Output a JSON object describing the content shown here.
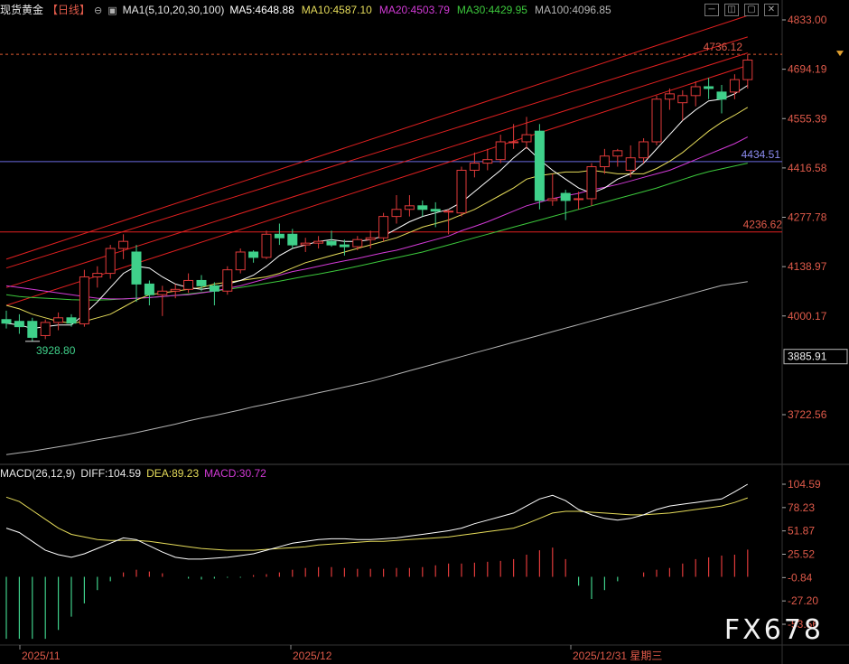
{
  "header": {
    "symbol": "现货黄金",
    "period": "【日线】",
    "ma_group": "MA1(5,10,20,30,100)",
    "ma5": "MA5:4648.88",
    "ma10": "MA10:4587.10",
    "ma20": "MA20:4503.79",
    "ma30": "MA30:4429.95",
    "ma100": "MA100:4096.85"
  },
  "macd_header": {
    "name": "MACD(26,12,9)",
    "diff": "DIFF:104.59",
    "dea": "DEA:89.23",
    "macd": "MACD:30.72"
  },
  "colors": {
    "up": "#e03a3a",
    "down": "#3fd08a",
    "ma5": "#ffffff",
    "ma10": "#e6dc5a",
    "ma20": "#d23ad6",
    "ma30": "#3cc83c",
    "ma100": "#b4b4b4",
    "channel": "#e02020",
    "diff": "#ffffff",
    "dea": "#e6dc5a"
  },
  "watermark": "FX678",
  "chart_data": {
    "type": "candlestick",
    "price_axis": {
      "ticks": [
        "4833.00",
        "4694.19",
        "4555.39",
        "4416.58",
        "4277.78",
        "4138.97",
        "4000.17",
        "3722.56"
      ]
    },
    "price_labels": {
      "last": "3885.91",
      "high_marker": "4736.12",
      "low_marker": "3928.80",
      "blue_level": "4434.51",
      "red_level": "4236.62"
    },
    "macd_axis": {
      "ticks": [
        "104.59",
        "78.23",
        "51.87",
        "25.52",
        "-0.84",
        "-27.20",
        "-53.56"
      ]
    },
    "time_axis": {
      "labels": [
        "2025/11",
        "2025/12",
        "2025/12/31 星期三"
      ]
    },
    "horizontal_levels": [
      4736.12,
      4434.51,
      4236.62
    ],
    "channel_lines": [
      {
        "from": [
          0,
          4160
        ],
        "to": [
          57,
          4845
        ]
      },
      {
        "from": [
          0,
          4135
        ],
        "to": [
          57,
          4785
        ]
      },
      {
        "from": [
          0,
          4080
        ],
        "to": [
          57,
          4740
        ]
      },
      {
        "from": [
          0,
          4030
        ],
        "to": [
          57,
          4705
        ]
      }
    ],
    "candles": [
      {
        "o": 3990,
        "h": 4015,
        "l": 3965,
        "c": 3980
      },
      {
        "o": 3985,
        "h": 4005,
        "l": 3950,
        "c": 3970
      },
      {
        "o": 3985,
        "h": 3995,
        "l": 3928.8,
        "c": 3940
      },
      {
        "o": 3945,
        "h": 3990,
        "l": 3935,
        "c": 3982
      },
      {
        "o": 3982,
        "h": 4010,
        "l": 3960,
        "c": 3995
      },
      {
        "o": 3995,
        "h": 4005,
        "l": 3970,
        "c": 3980
      },
      {
        "o": 3978,
        "h": 4130,
        "l": 3970,
        "c": 4110
      },
      {
        "o": 4110,
        "h": 4140,
        "l": 4080,
        "c": 4120
      },
      {
        "o": 4120,
        "h": 4200,
        "l": 4105,
        "c": 4190
      },
      {
        "o": 4190,
        "h": 4230,
        "l": 4160,
        "c": 4210
      },
      {
        "o": 4180,
        "h": 4200,
        "l": 4040,
        "c": 4090
      },
      {
        "o": 4090,
        "h": 4100,
        "l": 4030,
        "c": 4060
      },
      {
        "o": 4060,
        "h": 4085,
        "l": 4000,
        "c": 4070
      },
      {
        "o": 4070,
        "h": 4090,
        "l": 4050,
        "c": 4075
      },
      {
        "o": 4075,
        "h": 4120,
        "l": 4065,
        "c": 4100
      },
      {
        "o": 4100,
        "h": 4115,
        "l": 4070,
        "c": 4085
      },
      {
        "o": 4085,
        "h": 4095,
        "l": 4030,
        "c": 4070
      },
      {
        "o": 4070,
        "h": 4140,
        "l": 4060,
        "c": 4130
      },
      {
        "o": 4130,
        "h": 4190,
        "l": 4120,
        "c": 4180
      },
      {
        "o": 4180,
        "h": 4185,
        "l": 4150,
        "c": 4165
      },
      {
        "o": 4165,
        "h": 4240,
        "l": 4160,
        "c": 4230
      },
      {
        "o": 4230,
        "h": 4260,
        "l": 4200,
        "c": 4220
      },
      {
        "o": 4230,
        "h": 4245,
        "l": 4190,
        "c": 4200
      },
      {
        "o": 4200,
        "h": 4220,
        "l": 4180,
        "c": 4205
      },
      {
        "o": 4205,
        "h": 4225,
        "l": 4190,
        "c": 4210
      },
      {
        "o": 4210,
        "h": 4240,
        "l": 4195,
        "c": 4200
      },
      {
        "o": 4200,
        "h": 4215,
        "l": 4170,
        "c": 4195
      },
      {
        "o": 4195,
        "h": 4225,
        "l": 4185,
        "c": 4215
      },
      {
        "o": 4215,
        "h": 4240,
        "l": 4190,
        "c": 4220
      },
      {
        "o": 4220,
        "h": 4290,
        "l": 4210,
        "c": 4280
      },
      {
        "o": 4280,
        "h": 4340,
        "l": 4260,
        "c": 4300
      },
      {
        "o": 4300,
        "h": 4340,
        "l": 4280,
        "c": 4310
      },
      {
        "o": 4310,
        "h": 4325,
        "l": 4280,
        "c": 4300
      },
      {
        "o": 4300,
        "h": 4320,
        "l": 4250,
        "c": 4295
      },
      {
        "o": 4295,
        "h": 4300,
        "l": 4230,
        "c": 4295
      },
      {
        "o": 4290,
        "h": 4420,
        "l": 4280,
        "c": 4410
      },
      {
        "o": 4410,
        "h": 4460,
        "l": 4390,
        "c": 4430
      },
      {
        "o": 4430,
        "h": 4470,
        "l": 4410,
        "c": 4440
      },
      {
        "o": 4440,
        "h": 4510,
        "l": 4430,
        "c": 4490
      },
      {
        "o": 4490,
        "h": 4540,
        "l": 4470,
        "c": 4490
      },
      {
        "o": 4490,
        "h": 4560,
        "l": 4470,
        "c": 4510
      },
      {
        "o": 4520,
        "h": 4540,
        "l": 4300,
        "c": 4325
      },
      {
        "o": 4325,
        "h": 4400,
        "l": 4310,
        "c": 4330
      },
      {
        "o": 4345,
        "h": 4355,
        "l": 4270,
        "c": 4325
      },
      {
        "o": 4330,
        "h": 4350,
        "l": 4300,
        "c": 4330
      },
      {
        "o": 4330,
        "h": 4430,
        "l": 4310,
        "c": 4420
      },
      {
        "o": 4420,
        "h": 4470,
        "l": 4400,
        "c": 4450
      },
      {
        "o": 4450,
        "h": 4470,
        "l": 4420,
        "c": 4465
      },
      {
        "o": 4410,
        "h": 4480,
        "l": 4390,
        "c": 4445
      },
      {
        "o": 4445,
        "h": 4500,
        "l": 4430,
        "c": 4490
      },
      {
        "o": 4490,
        "h": 4620,
        "l": 4480,
        "c": 4610
      },
      {
        "o": 4610,
        "h": 4640,
        "l": 4580,
        "c": 4625
      },
      {
        "o": 4600,
        "h": 4635,
        "l": 4550,
        "c": 4620
      },
      {
        "o": 4620,
        "h": 4660,
        "l": 4590,
        "c": 4645
      },
      {
        "o": 4645,
        "h": 4670,
        "l": 4610,
        "c": 4640
      },
      {
        "o": 4630,
        "h": 4650,
        "l": 4570,
        "c": 4610
      },
      {
        "o": 4630,
        "h": 4680,
        "l": 4610,
        "c": 4665
      },
      {
        "o": 4665,
        "h": 4736.12,
        "l": 4640,
        "c": 4720
      }
    ],
    "ma": {
      "ma5": [
        3980,
        3975,
        3965,
        3970,
        3975,
        3975,
        4005,
        4040,
        4080,
        4120,
        4140,
        4135,
        4110,
        4090,
        4080,
        4075,
        4080,
        4090,
        4100,
        4115,
        4140,
        4170,
        4190,
        4200,
        4210,
        4215,
        4210,
        4210,
        4215,
        4225,
        4245,
        4265,
        4280,
        4290,
        4300,
        4320,
        4350,
        4380,
        4410,
        4445,
        4475,
        4440,
        4410,
        4385,
        4360,
        4345,
        4360,
        4385,
        4400,
        4430,
        4470,
        4510,
        4550,
        4580,
        4605,
        4610,
        4625,
        4648.88
      ],
      "ma10": [
        4030,
        4020,
        4005,
        3995,
        3985,
        3980,
        3985,
        3995,
        4005,
        4025,
        4045,
        4060,
        4065,
        4070,
        4075,
        4080,
        4090,
        4095,
        4100,
        4105,
        4110,
        4120,
        4135,
        4150,
        4160,
        4170,
        4180,
        4190,
        4200,
        4210,
        4220,
        4235,
        4250,
        4260,
        4270,
        4285,
        4300,
        4320,
        4340,
        4360,
        4385,
        4395,
        4400,
        4405,
        4405,
        4410,
        4405,
        4400,
        4400,
        4400,
        4415,
        4435,
        4460,
        4490,
        4520,
        4545,
        4565,
        4587.1
      ],
      "ma20": [
        4085,
        4080,
        4075,
        4070,
        4065,
        4060,
        4055,
        4050,
        4048,
        4048,
        4050,
        4052,
        4055,
        4058,
        4060,
        4065,
        4070,
        4078,
        4085,
        4095,
        4105,
        4115,
        4125,
        4132,
        4140,
        4148,
        4155,
        4162,
        4170,
        4178,
        4185,
        4195,
        4205,
        4215,
        4225,
        4240,
        4252,
        4265,
        4280,
        4295,
        4310,
        4320,
        4330,
        4338,
        4345,
        4355,
        4362,
        4370,
        4380,
        4390,
        4400,
        4410,
        4425,
        4440,
        4455,
        4470,
        4485,
        4503.79
      ],
      "ma30": [
        4060,
        4055,
        4052,
        4050,
        4048,
        4046,
        4045,
        4045,
        4046,
        4048,
        4050,
        4052,
        4055,
        4058,
        4062,
        4066,
        4070,
        4075,
        4080,
        4086,
        4092,
        4098,
        4105,
        4112,
        4118,
        4125,
        4132,
        4140,
        4148,
        4156,
        4164,
        4172,
        4180,
        4190,
        4200,
        4210,
        4220,
        4230,
        4240,
        4250,
        4260,
        4270,
        4280,
        4290,
        4300,
        4310,
        4320,
        4330,
        4340,
        4350,
        4360,
        4372,
        4384,
        4396,
        4406,
        4414,
        4422,
        4429.95
      ],
      "ma100": [
        3610,
        3615,
        3620,
        3626,
        3632,
        3638,
        3645,
        3652,
        3658,
        3665,
        3672,
        3680,
        3688,
        3696,
        3705,
        3713,
        3720,
        3728,
        3736,
        3745,
        3752,
        3760,
        3768,
        3776,
        3784,
        3792,
        3800,
        3808,
        3816,
        3826,
        3836,
        3846,
        3856,
        3866,
        3876,
        3886,
        3896,
        3906,
        3916,
        3926,
        3936,
        3946,
        3956,
        3966,
        3976,
        3986,
        3996,
        4006,
        4016,
        4026,
        4036,
        4046,
        4056,
        4066,
        4076,
        4086,
        4091,
        4096.85
      ]
    },
    "macd": {
      "diff": [
        55,
        50,
        40,
        30,
        25,
        22,
        26,
        32,
        38,
        44,
        42,
        35,
        28,
        22,
        20,
        20,
        21,
        22,
        24,
        26,
        30,
        34,
        38,
        40,
        42,
        43,
        43,
        42,
        42,
        43,
        44,
        46,
        48,
        50,
        52,
        55,
        60,
        64,
        68,
        72,
        80,
        88,
        92,
        86,
        76,
        70,
        66,
        64,
        66,
        70,
        76,
        80,
        82,
        84,
        86,
        88,
        96,
        104.59
      ],
      "dea": [
        90,
        85,
        75,
        65,
        55,
        48,
        45,
        42,
        41,
        41,
        41,
        40,
        38,
        36,
        34,
        32,
        31,
        30,
        30,
        30,
        31,
        32,
        33,
        34,
        36,
        37,
        38,
        39,
        40,
        40,
        41,
        42,
        43,
        44,
        45,
        47,
        49,
        51,
        53,
        55,
        60,
        66,
        72,
        74,
        74,
        73,
        72,
        71,
        70,
        70,
        71,
        72,
        74,
        76,
        78,
        80,
        84,
        89.23
      ],
      "hist": [
        -70,
        -70,
        -70,
        -70,
        -60,
        -45,
        -30,
        -15,
        -5,
        5,
        8,
        6,
        4,
        0,
        -2,
        -3,
        -2,
        -1,
        -1,
        2,
        3,
        5,
        8,
        10,
        11,
        11,
        10,
        9,
        9,
        9,
        10,
        10,
        11,
        13,
        15,
        15,
        16,
        17,
        18,
        20,
        25,
        30,
        33,
        20,
        -10,
        -25,
        -15,
        -5,
        0,
        5,
        8,
        10,
        15,
        20,
        22,
        24,
        25,
        30.72
      ]
    }
  }
}
